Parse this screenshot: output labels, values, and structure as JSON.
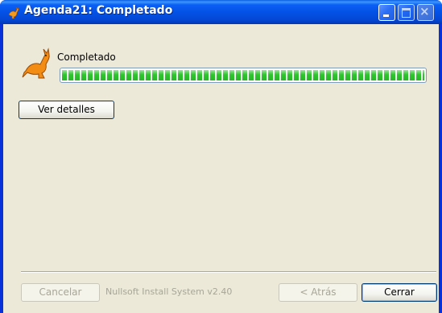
{
  "window": {
    "title": "Agenda21: Completado",
    "app_icon": "kangaroo-icon"
  },
  "titlebar_buttons": {
    "minimize_icon": "minimize-icon",
    "maximize_icon": "maximize-icon",
    "close_icon": "close-icon",
    "close_glyph": "×"
  },
  "main": {
    "status_text": "Completado",
    "progress_fraction": 1.0,
    "details_button": "Ver detalles"
  },
  "footer": {
    "branding": "Nullsoft Install System v2.40",
    "cancel_button": "Cancelar",
    "back_button": "< Atrás",
    "close_button": "Cerrar"
  },
  "colors": {
    "titlebar": "#0452e6",
    "client_bg": "#ece9d8",
    "progress_green": "#2ec52e",
    "kangaroo": "#e8860c"
  }
}
